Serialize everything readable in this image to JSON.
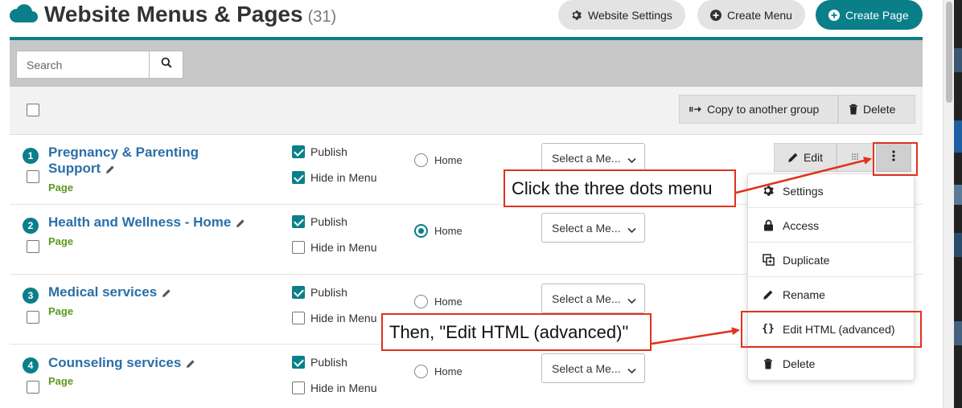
{
  "header": {
    "title": "Website Menus & Pages",
    "count": "(31)",
    "settings_label": "Website Settings",
    "create_menu_label": "Create Menu",
    "create_page_label": "Create Page"
  },
  "search": {
    "placeholder": "Search"
  },
  "toolbar": {
    "copy_label": "Copy to another group",
    "delete_label": "Delete"
  },
  "rows": [
    {
      "num": "1",
      "name_line1": "Pregnancy & Parenting",
      "name_line2": "Support",
      "type": "Page",
      "publish": "Publish",
      "hide": "Hide in Menu",
      "publish_checked": true,
      "hide_checked": true,
      "home": "Home",
      "home_selected": false,
      "select": "Select a Me..."
    },
    {
      "num": "2",
      "name_line1": "Health and Wellness - Home",
      "type": "Page",
      "publish": "Publish",
      "hide": "Hide in Menu",
      "publish_checked": true,
      "hide_checked": false,
      "home": "Home",
      "home_selected": true,
      "select": "Select a Me..."
    },
    {
      "num": "3",
      "name_line1": "Medical services",
      "type": "Page",
      "publish": "Publish",
      "hide": "Hide in Menu",
      "publish_checked": true,
      "hide_checked": false,
      "home": "Home",
      "home_selected": false,
      "select": "Select a Me..."
    },
    {
      "num": "4",
      "name_line1": "Counseling services",
      "type": "Page",
      "publish": "Publish",
      "hide": "Hide in Menu",
      "publish_checked": true,
      "hide_checked": false,
      "home": "Home",
      "home_selected": false,
      "select": "Select a Me..."
    }
  ],
  "row_actions": {
    "edit_label": "Edit"
  },
  "menu": {
    "items": [
      {
        "label": "Settings",
        "icon": "gear-icon"
      },
      {
        "label": "Access",
        "icon": "lock-icon"
      },
      {
        "label": "Duplicate",
        "icon": "duplicate-icon"
      },
      {
        "label": "Rename",
        "icon": "pencil-icon"
      },
      {
        "label": "Edit HTML (advanced)",
        "icon": "code-braces-icon"
      },
      {
        "label": "Delete",
        "icon": "trash-icon"
      }
    ]
  },
  "annotations": {
    "callout1": "Click the three dots menu",
    "callout2": "Then, \"Edit HTML (advanced)\""
  },
  "colors": {
    "accent": "#0b7f89",
    "link": "#2a6fa8",
    "page_type": "#5a9a1c",
    "annotation": "#e0321c"
  }
}
